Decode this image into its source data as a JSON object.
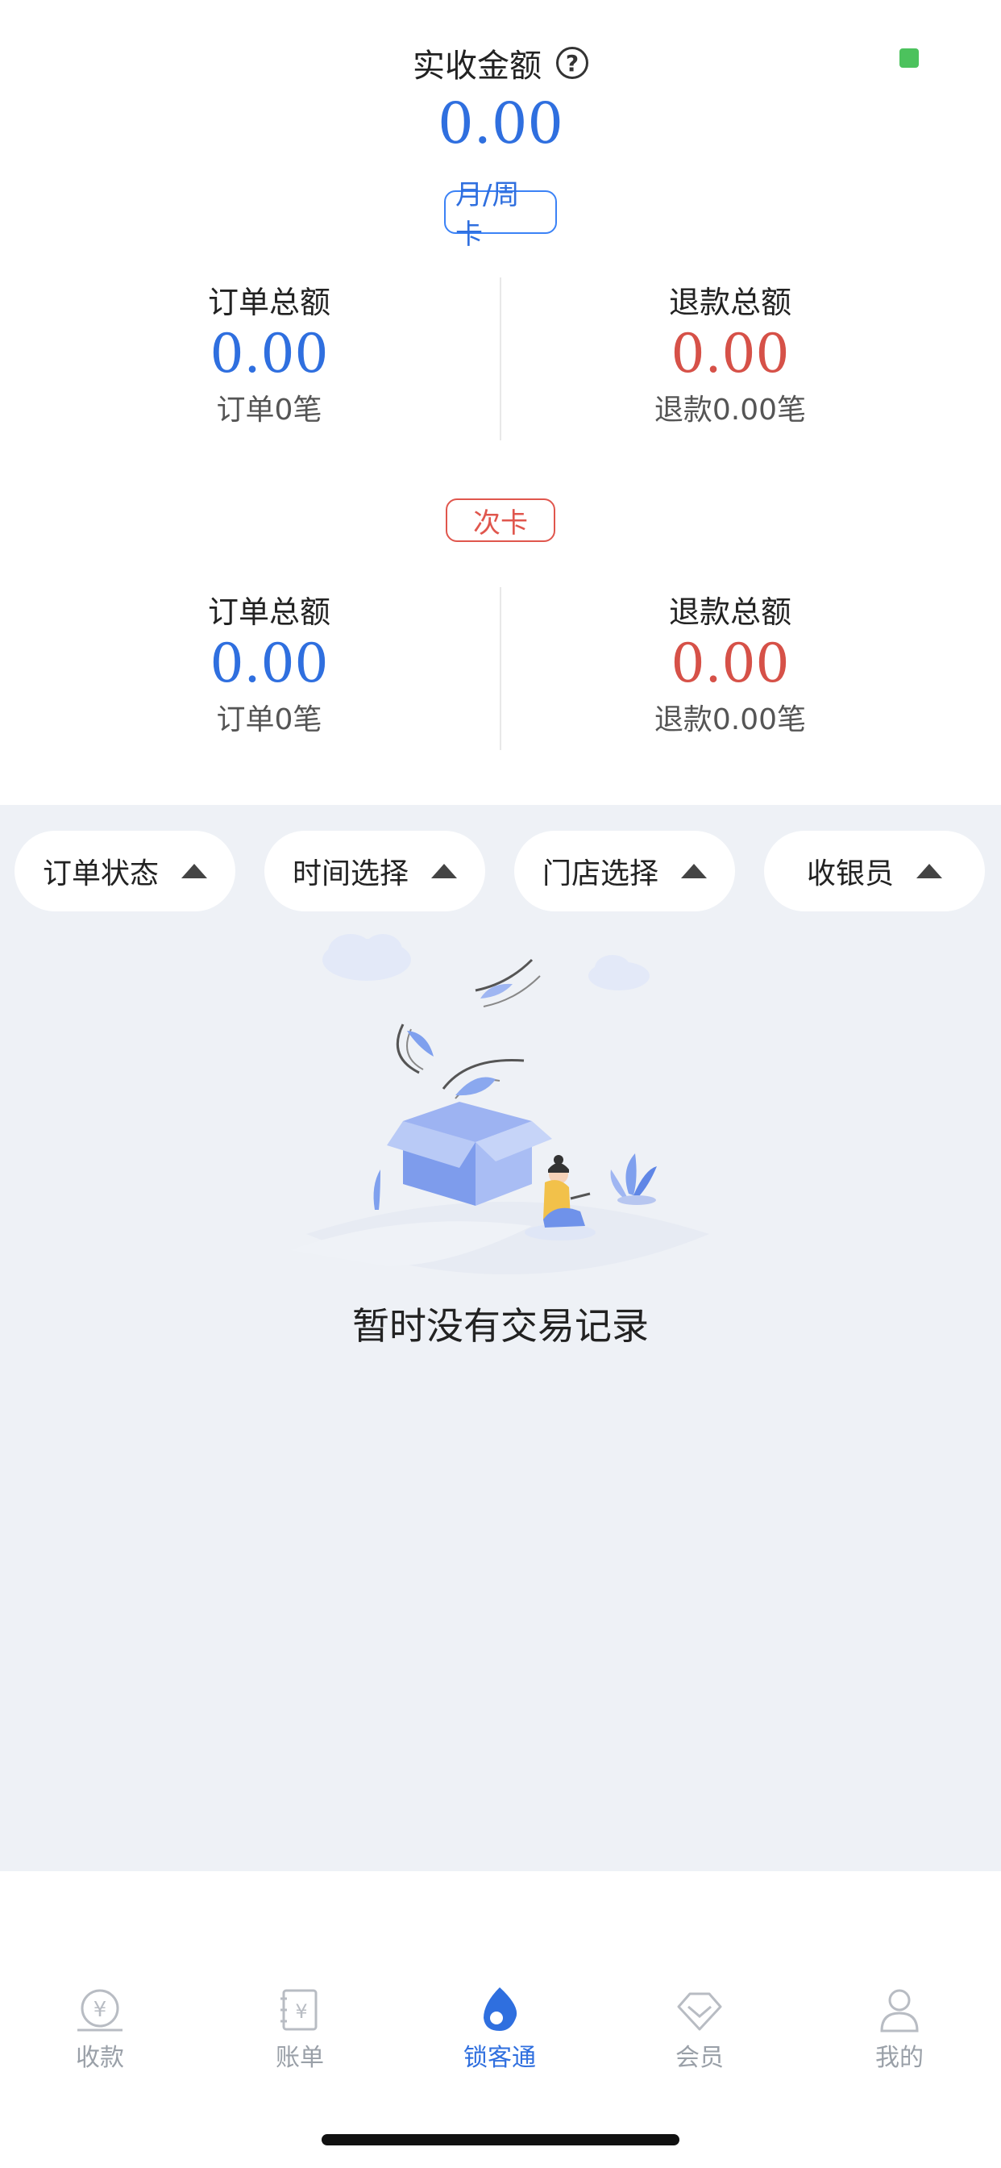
{
  "summary": {
    "title": "实收金额",
    "amount": "0.00"
  },
  "monthly_card": {
    "tag": "月/周卡",
    "order_label": "订单总额",
    "order_amount": "0.00",
    "order_count": "订单0笔",
    "refund_label": "退款总额",
    "refund_amount": "0.00",
    "refund_count": "退款0.00笔"
  },
  "times_card": {
    "tag": "次卡",
    "order_label": "订单总额",
    "order_amount": "0.00",
    "order_count": "订单0笔",
    "refund_label": "退款总额",
    "refund_amount": "0.00",
    "refund_count": "退款0.00笔"
  },
  "filters": [
    {
      "label": "订单状态"
    },
    {
      "label": "时间选择"
    },
    {
      "label": "门店选择"
    },
    {
      "label": "收银员"
    }
  ],
  "empty_state": {
    "message": "暂时没有交易记录"
  },
  "bottom_nav": [
    {
      "label": "收款",
      "icon": "yen-coin-icon",
      "active": false
    },
    {
      "label": "账单",
      "icon": "bill-icon",
      "active": false
    },
    {
      "label": "锁客通",
      "icon": "drop-icon",
      "active": true
    },
    {
      "label": "会员",
      "icon": "diamond-icon",
      "active": false
    },
    {
      "label": "我的",
      "icon": "user-icon",
      "active": false
    }
  ],
  "colors": {
    "accent_blue": "#2f6fdf",
    "refund_red": "#d65148",
    "status_green": "#4cc25d",
    "background_grey": "#eef1f6"
  }
}
